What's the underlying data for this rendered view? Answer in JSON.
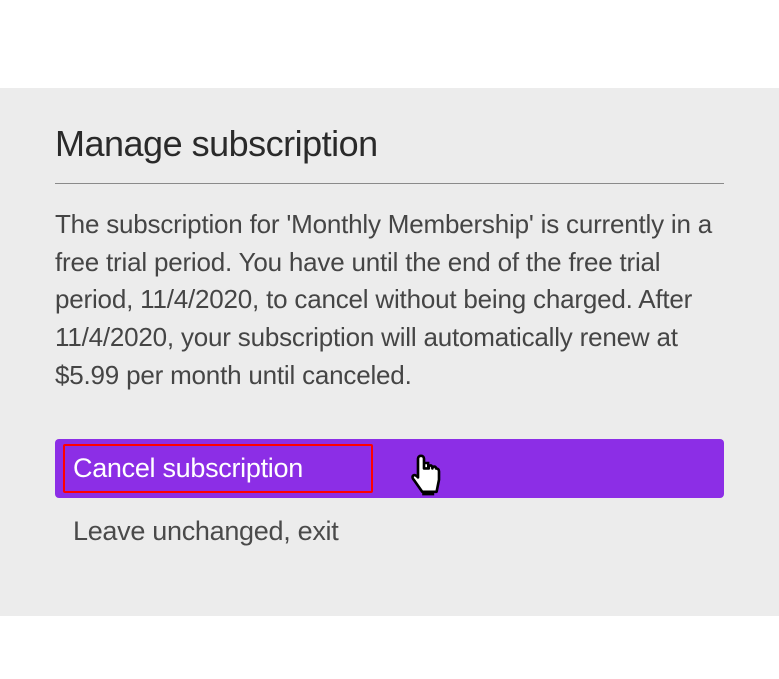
{
  "title": "Manage subscription",
  "description": "The subscription for 'Monthly Membership' is currently in a free trial period. You have until the end of the free trial period, 11/4/2020, to cancel without being charged. After 11/4/2020, your subscription will automatically renew at $5.99 per month until canceled.",
  "buttons": {
    "cancel": "Cancel subscription",
    "exit": "Leave unchanged, exit"
  }
}
